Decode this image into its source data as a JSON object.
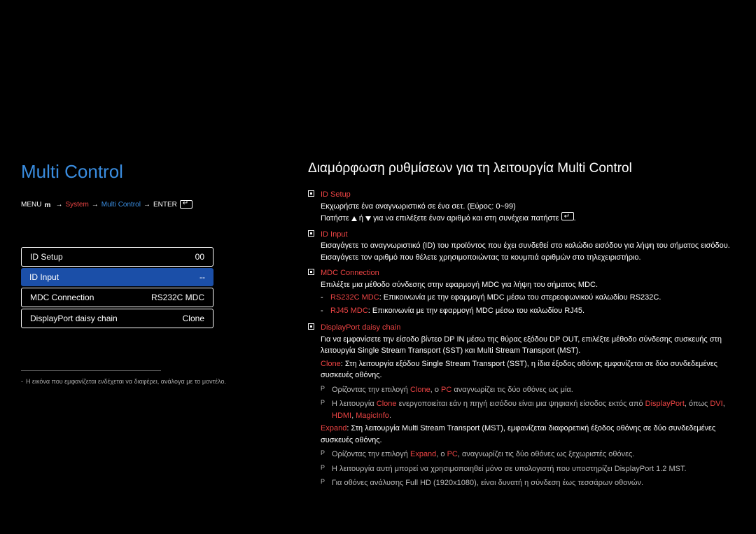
{
  "title": "Multi Control",
  "breadcrumb": {
    "menu": "MENU",
    "system": "System",
    "multiControl": "Multi Control",
    "enter": "ENTER"
  },
  "menu": [
    {
      "label": "ID Setup",
      "value": "00",
      "style": "outline"
    },
    {
      "label": "ID Input",
      "value": "--",
      "style": "highlight"
    },
    {
      "label": "MDC Connection",
      "value": "RS232C MDC",
      "style": "outline"
    },
    {
      "label": "DisplayPort daisy chain",
      "value": "Clone",
      "style": "outline"
    }
  ],
  "imageNote": "Η εικόνα που εμφανίζεται ενδέχεται να διαφέρει, ανάλογα με το μοντέλο.",
  "descTitle": "Διαμόρφωση ρυθμίσεων για τη λειτουργία Multi Control",
  "idSetup": {
    "name": "ID Setup",
    "line1": "Εκχωρήστε ένα αναγνωριστικό σε ένα σετ. (Εύρος: 0~99)",
    "line2a": "Πατήστε ",
    "line2b": " ή ",
    "line2c": " για να επιλέξετε έναν αριθμό και στη συνέχεια πατήστε "
  },
  "idInput": {
    "name": "ID Input",
    "line1": "Εισαγάγετε το αναγνωριστικό (ID) του προϊόντος που έχει συνδεθεί στο καλώδιο εισόδου για λήψη του σήματος εισόδου.",
    "line2": "Εισαγάγετε τον αριθμό που θέλετε χρησιμοποιώντας τα κουμπιά αριθμών στο τηλεχειριστήριο."
  },
  "mdc": {
    "name": "MDC Connection",
    "line1": "Επιλέξτε μια μέθοδο σύνδεσης στην εφαρμογή MDC για λήψη του σήματος MDC.",
    "rs232c": {
      "label": "RS232C MDC",
      "text": ": Επικοινωνία με την εφαρμογή MDC μέσω του στερεοφωνικού καλωδίου RS232C."
    },
    "rj45": {
      "label": "RJ45 MDC",
      "text": ": Επικοινωνία με την εφαρμογή MDC μέσω του καλωδίου RJ45."
    }
  },
  "dp": {
    "name": "DisplayPort daisy chain",
    "intro": "Για να εμφανίσετε την είσοδο βίντεο DP IN μέσω της θύρας εξόδου DP OUT, επιλέξτε μέθοδο σύνδεσης συσκευής στη λειτουργία Single Stream Transport (SST) και Multi Stream Transport (MST).",
    "clone": {
      "label": "Clone",
      "text": ": Στη λειτουργία εξόδου Single Stream Transport (SST), η ίδια έξοδος οθόνης εμφανίζεται σε δύο συνδεδεμένες συσκευές οθόνης."
    },
    "cloneP1a": "Ορίζοντας την επιλογή ",
    "cloneP1b": "Clone",
    "cloneP1c": ", ο ",
    "cloneP1d": "PC",
    "cloneP1e": " αναγνωρίζει τις δύο οθόνες ως μία.",
    "cloneP2a": "Η λειτουργία ",
    "cloneP2b": "Clone",
    "cloneP2c": " ενεργοποιείται εάν η πηγή εισόδου είναι μια ψηφιακή είσοδος εκτός από ",
    "cloneP2d": "DisplayPort",
    "cloneP2e": ", όπως ",
    "cloneP2f": "DVI",
    "cloneP2g": ", ",
    "cloneP2h": "HDMI",
    "cloneP2i": ", ",
    "cloneP2j": "MagicInfo",
    "cloneP2k": ".",
    "expand": {
      "label": "Expand",
      "text": ": Στη λειτουργία Multi Stream Transport (MST), εμφανίζεται διαφορετική έξοδος οθόνης σε δύο συνδεδεμένες συσκευές οθόνης."
    },
    "expandP1a": "Ορίζοντας την επιλογή ",
    "expandP1b": "Expand",
    "expandP1c": ", ο ",
    "expandP1d": "PC",
    "expandP1e": ", αναγνωρίζει τις δύο οθόνες ως ξεχωριστές οθόνες.",
    "expandP2": "Η λειτουργία αυτή μπορεί να χρησιμοποιηθεί μόνο σε υπολογιστή που υποστηρίζει DisplayPort 1.2 MST.",
    "expandP3": "Για οθόνες ανάλυσης Full HD (1920x1080), είναι δυνατή η σύνδεση έως τεσσάρων οθονών."
  }
}
